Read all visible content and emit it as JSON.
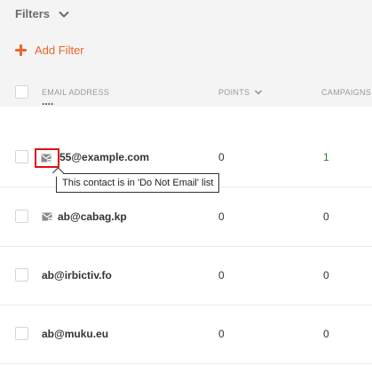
{
  "filters": {
    "label": "Filters",
    "toggle_icon": "chevron-down-icon"
  },
  "add_filter": {
    "label": "Add Filter",
    "icon": "plus-icon",
    "color": "#e8662c"
  },
  "table": {
    "columns": {
      "email": "EMAIL ADDRESS",
      "points": "POINTS",
      "campaigns": "CAMPAIGNS"
    },
    "partial_row_text": "....",
    "rows": [
      {
        "email": "55@example.com",
        "points": "0",
        "campaigns": "1",
        "do_not_email": true
      },
      {
        "email": "ab@cabag.kp",
        "points": "0",
        "campaigns": "0",
        "do_not_email": true
      },
      {
        "email": "ab@irbictiv.fo",
        "points": "0",
        "campaigns": "0",
        "do_not_email": false
      },
      {
        "email": "ab@muku.eu",
        "points": "0",
        "campaigns": "0",
        "do_not_email": false
      }
    ]
  },
  "tooltip": {
    "text": "This contact is in 'Do Not Email' list"
  },
  "colors": {
    "accent": "#e8662c",
    "highlight": "#e01010",
    "campaign_link": "#2e7d32"
  }
}
